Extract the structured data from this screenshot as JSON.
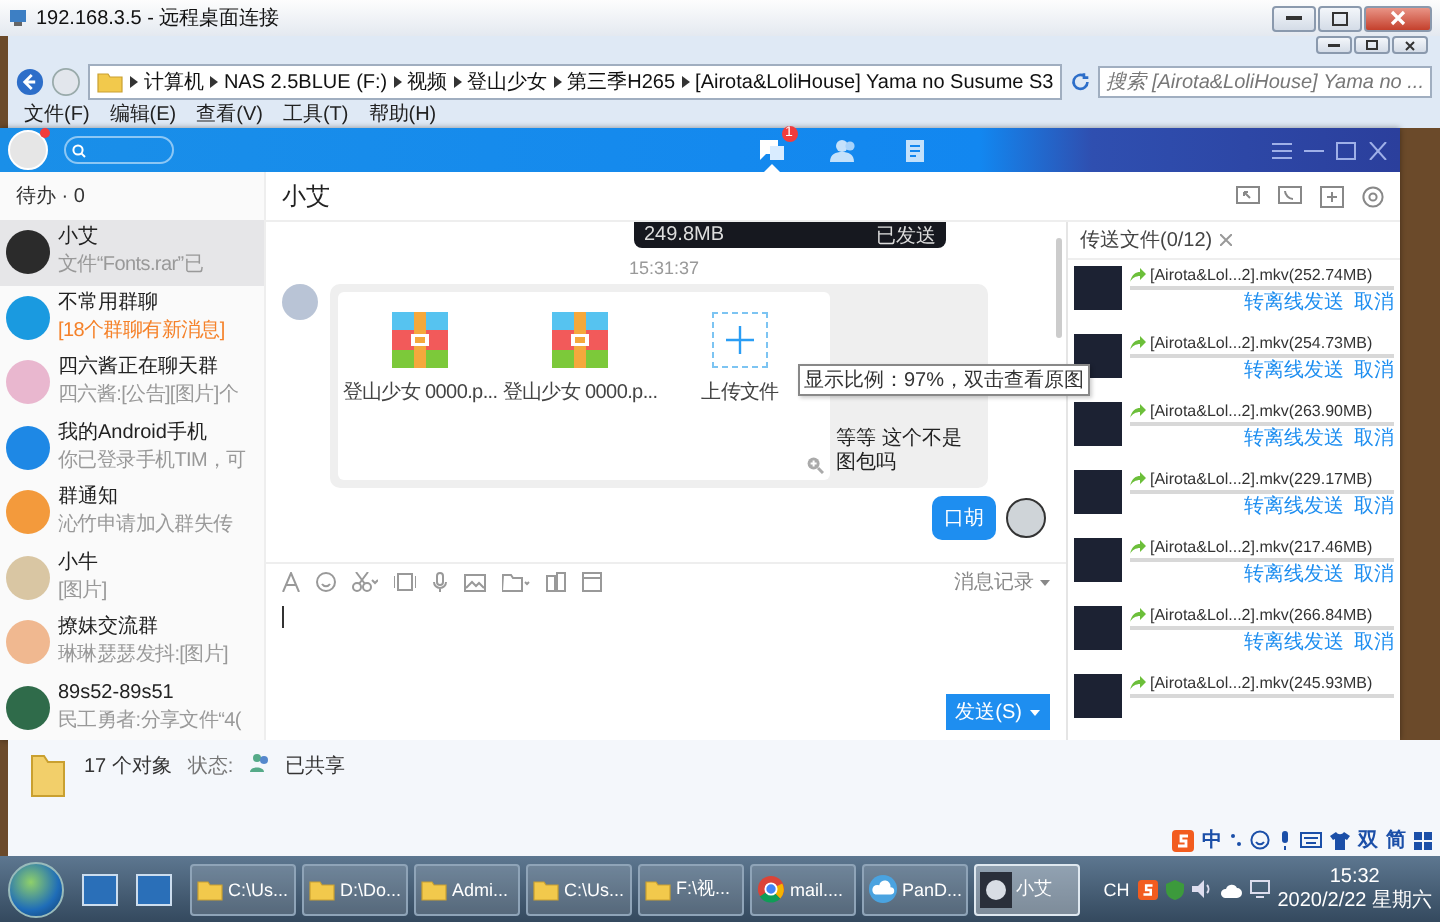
{
  "remote_desktop": {
    "title": "192.168.3.5 - 远程桌面连接"
  },
  "explorer": {
    "breadcrumbs": [
      "计算机",
      "NAS 2.5BLUE (F:)",
      "视频",
      "登山少女",
      "第三季H265",
      "[Airota&LoliHouse] Yama no Susume S3"
    ],
    "search": {
      "placeholder": "搜索 [Airota&LoliHouse] Yama no ..."
    },
    "menu": [
      "文件(F)",
      "编辑(E)",
      "查看(V)",
      "工具(T)",
      "帮助(H)"
    ],
    "status": {
      "count": "17 个对象",
      "state_label": "状态:",
      "state": "已共享"
    }
  },
  "tim": {
    "nav": [
      {
        "kind": "chat",
        "selected": true,
        "badge": "1"
      },
      {
        "kind": "contacts",
        "selected": false
      },
      {
        "kind": "notes",
        "selected": false
      }
    ],
    "todo": "待办 · 0",
    "conversations": [
      {
        "name": "小艾",
        "preview": "文件“Fonts.rar”已",
        "selected": true,
        "notice": false
      },
      {
        "name": "不常用群聊",
        "preview": "[18个群聊有新消息]",
        "selected": false,
        "notice": true
      },
      {
        "name": "四六酱正在聊天群",
        "preview": "四六酱:[公告][图片]个",
        "selected": false,
        "notice": false
      },
      {
        "name": "我的Android手机",
        "preview": "你已登录手机TIM，可",
        "selected": false,
        "notice": false
      },
      {
        "name": "群通知",
        "preview": "沁竹申请加入群失传",
        "selected": false,
        "notice": false
      },
      {
        "name": "小牛",
        "preview": "[图片]",
        "selected": false,
        "notice": false
      },
      {
        "name": "撩妹交流群",
        "preview": "琳琳瑟瑟发抖:[图片]",
        "selected": false,
        "notice": false
      },
      {
        "name": "89s52-89s51",
        "preview": "民工勇者:分享文件“4(",
        "selected": false,
        "notice": false
      }
    ],
    "chat": {
      "title": "小艾",
      "sent_file": {
        "size": "249.8MB",
        "status": "已发送"
      },
      "time": "15:31:37",
      "album": {
        "files": [
          "登山少女 0000.p...",
          "登山少女 0000.p..."
        ],
        "upload": "上传文件",
        "tooltip": "显示比例：97%，双击查看原图",
        "caption": "等等 这个不是图包吗"
      },
      "reply": "口胡",
      "history": "消息记录",
      "send": "发送(S)"
    },
    "transfers": {
      "tab": "传送文件(0/12)",
      "items": [
        {
          "name": "[Airota&Lol...2].mkv(252.74MB)",
          "level": 0,
          "actions": [
            "转离线发送",
            "取消"
          ]
        },
        {
          "name": "[Airota&Lol...2].mkv(254.73MB)",
          "level": 0,
          "actions": [
            "转离线发送",
            "取消"
          ]
        },
        {
          "name": "[Airota&Lol...2].mkv(263.90MB)",
          "level": 0,
          "actions": [
            "转离线发送",
            "取消"
          ]
        },
        {
          "name": "[Airota&Lol...2].mkv(229.17MB)",
          "level": 0,
          "actions": [
            "转离线发送",
            "取消"
          ]
        },
        {
          "name": "[Airota&Lol...2].mkv(217.46MB)",
          "level": 0,
          "actions": [
            "转离线发送",
            "取消"
          ]
        },
        {
          "name": "[Airota&Lol...2].mkv(266.84MB)",
          "level": 0,
          "actions": [
            "转离线发送",
            "取消"
          ]
        },
        {
          "name": "[Airota&Lol...2].mkv(245.93MB)",
          "level": 0
        }
      ]
    }
  },
  "ime": {
    "mode": "中",
    "width": "双",
    "script": "简"
  },
  "taskbar": {
    "items": [
      {
        "kind": "folder",
        "label": "C:\\Us...",
        "selected": false
      },
      {
        "kind": "folder",
        "label": "D:\\Do...",
        "selected": false
      },
      {
        "kind": "folder",
        "label": "Admi...",
        "selected": false
      },
      {
        "kind": "folder",
        "label": "C:\\Us...",
        "selected": false
      },
      {
        "kind": "folder",
        "label": "F:\\视...",
        "selected": false
      },
      {
        "kind": "browser",
        "label": "mail....",
        "selected": false
      },
      {
        "kind": "cloud",
        "label": "PanD...",
        "selected": false
      },
      {
        "kind": "chat",
        "label": "小艾",
        "selected": true
      }
    ],
    "language": "CH",
    "time": "15:32",
    "date": "2020/2/22 星期六"
  }
}
